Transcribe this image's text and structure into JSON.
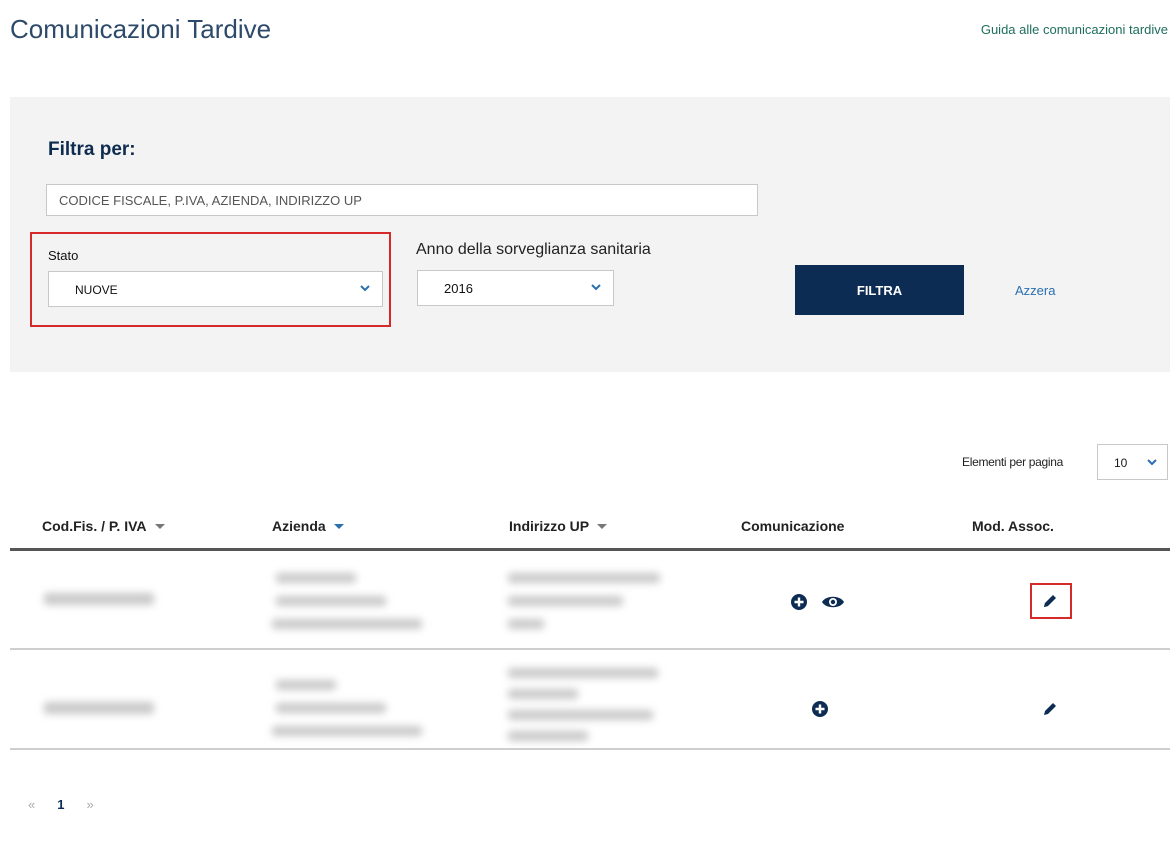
{
  "header": {
    "title": "Comunicazioni Tardive",
    "guide_link": "Guida alle comunicazioni tardive"
  },
  "filter": {
    "heading": "Filtra per:",
    "search_placeholder": "CODICE FISCALE, P.IVA, AZIENDA, INDIRIZZO UP",
    "stato_label": "Stato",
    "stato_value": "NUOVE",
    "anno_label": "Anno della sorveglianza sanitaria",
    "anno_value": "2016",
    "filter_button": "FILTRA",
    "reset_link": "Azzera"
  },
  "pagination_size": {
    "label": "Elementi per pagina",
    "value": "10"
  },
  "table": {
    "columns": [
      "Cod.Fis. / P. IVA",
      "Azienda",
      "Indirizzo UP",
      "Comunicazione",
      "Mod. Assoc."
    ],
    "rows": [
      {
        "communication_icons": [
          "plus-circle-icon",
          "eye-icon"
        ],
        "edit_icon": "pencil-icon",
        "edit_highlighted": true
      },
      {
        "communication_icons": [
          "plus-circle-icon"
        ],
        "edit_icon": "pencil-icon",
        "edit_highlighted": false
      }
    ]
  },
  "pagination": {
    "prev": "«",
    "current": "1",
    "next": "»"
  },
  "colors": {
    "title": "#2d4a6a",
    "primary_button": "#0d2c54",
    "highlight": "#d62a2a",
    "link": "#2a6fb0",
    "panel_bg": "#f3f3f3"
  }
}
